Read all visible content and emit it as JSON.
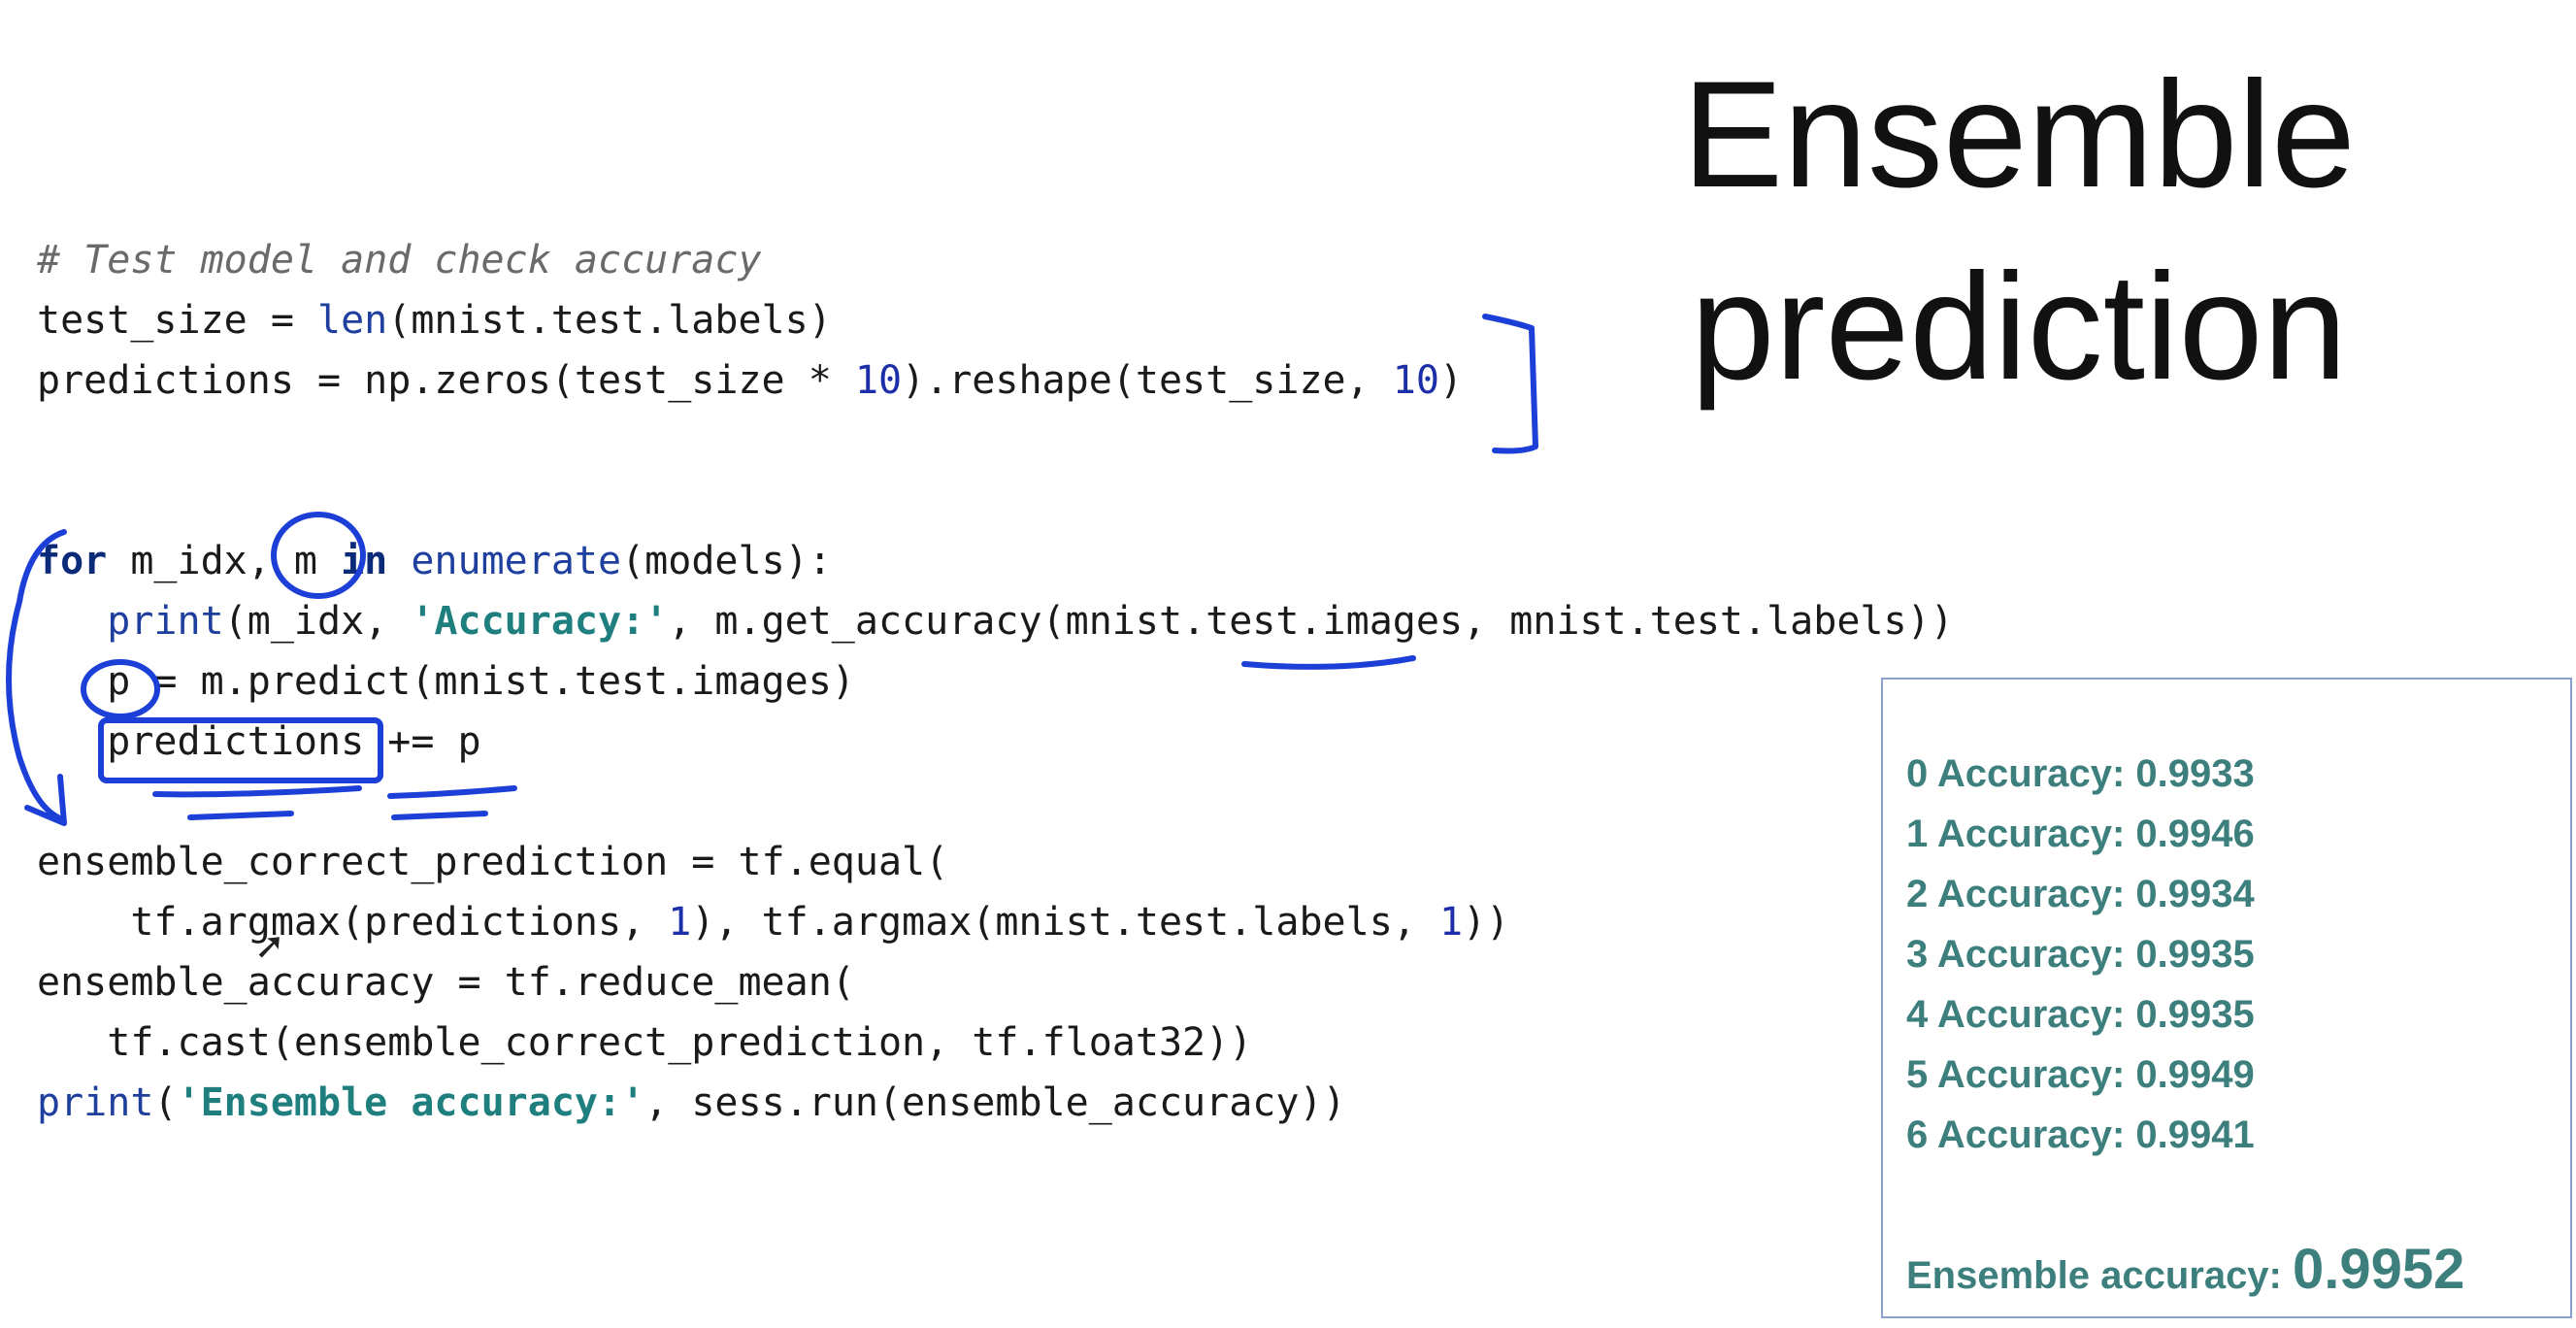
{
  "slide": {
    "title_line1": "Ensemble",
    "title_line2": "prediction"
  },
  "code": {
    "l1_comment": "# Test model and check accuracy",
    "l2_a": "test_size = ",
    "l2_len": "len",
    "l2_b": "(mnist.test.labels)",
    "l3_a": "predictions = np.zeros(test_size * ",
    "l3_n1": "10",
    "l3_b": ").reshape(test_size, ",
    "l3_n2": "10",
    "l3_c": ")",
    "l4_for": "for",
    "l4_a": " m_idx, m ",
    "l4_in": "in",
    "l4_sp": " ",
    "l4_enum": "enumerate",
    "l4_b": "(models):",
    "l5_indent": "   ",
    "l5_print": "print",
    "l5_a": "(m_idx, ",
    "l5_str": "'Accuracy:'",
    "l5_b": ", m.get_accuracy(mnist.test.images, mnist.test.labels))",
    "l6": "   p = m.predict(mnist.test.images)",
    "l7": "   predictions += p",
    "l8": "ensemble_correct_prediction = tf.equal(",
    "l9_a": "    tf.argmax(predictions, ",
    "l9_n1": "1",
    "l9_b": "), tf.argmax(mnist.test.labels, ",
    "l9_n2": "1",
    "l9_c": "))",
    "l10": "ensemble_accuracy = tf.reduce_mean(",
    "l11": "   tf.cast(ensemble_correct_prediction, tf.float32))",
    "l12_print": "print",
    "l12_a": "(",
    "l12_str": "'Ensemble accuracy:'",
    "l12_b": ", sess.run(ensemble_accuracy))"
  },
  "results": {
    "rows": [
      "0 Accuracy: 0.9933",
      "1 Accuracy: 0.9946",
      "2 Accuracy: 0.9934",
      "3 Accuracy: 0.9935",
      "4 Accuracy: 0.9935",
      "5 Accuracy: 0.9949",
      "6 Accuracy: 0.9941"
    ],
    "ensemble_label": "Ensemble accuracy: ",
    "ensemble_value": "0.9952"
  },
  "colors": {
    "keyword": "#0a2a7a",
    "string": "#1f7f7f",
    "number": "#1c2ea8",
    "results_text": "#3d7f7d",
    "ink": "#1c3fd8"
  }
}
